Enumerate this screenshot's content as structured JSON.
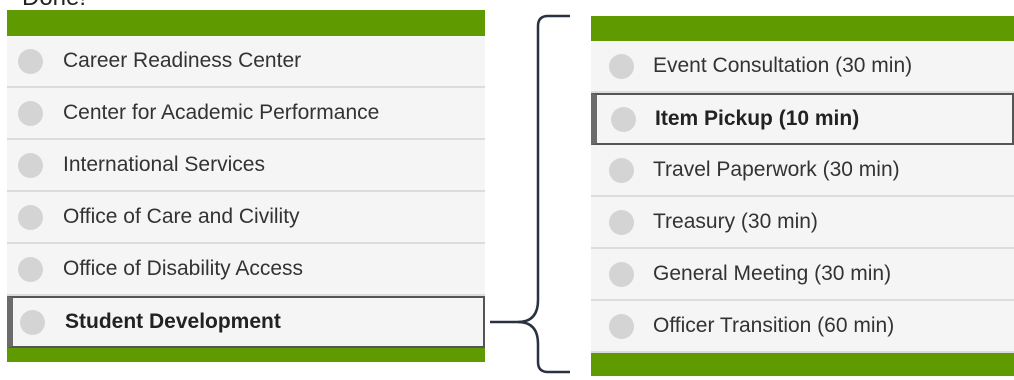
{
  "top_label": "Done!",
  "departments": {
    "items": [
      {
        "label": "Career Readiness Center",
        "selected": false
      },
      {
        "label": "Center for Academic Performance",
        "selected": false
      },
      {
        "label": "International Services",
        "selected": false
      },
      {
        "label": "Office of Care and Civility",
        "selected": false
      },
      {
        "label": "Office of Disability Access",
        "selected": false
      },
      {
        "label": "Student Development",
        "selected": true
      }
    ]
  },
  "services": {
    "items": [
      {
        "label": "Event Consultation (30 min)",
        "selected": false
      },
      {
        "label": "Item Pickup (10 min)",
        "selected": true
      },
      {
        "label": "Travel Paperwork (30 min)",
        "selected": false
      },
      {
        "label": "Treasury (30 min)",
        "selected": false
      },
      {
        "label": "General Meeting (30 min)",
        "selected": false
      },
      {
        "label": "Officer Transition (60 min)",
        "selected": false
      }
    ]
  },
  "colors": {
    "accent_green": "#5e9a00",
    "radio_gray": "#d4d4d4",
    "selected_border": "#555555"
  }
}
